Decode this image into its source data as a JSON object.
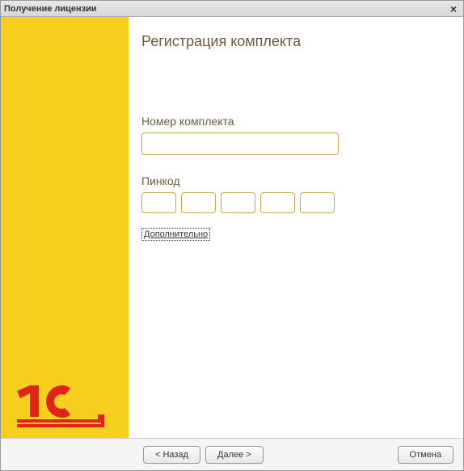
{
  "window": {
    "title": "Получение лицензии"
  },
  "main": {
    "heading": "Регистрация комплекта",
    "kit_label": "Номер комплекта",
    "kit_value": "",
    "pin_label": "Пинкод",
    "pin_values": [
      "",
      "",
      "",
      "",
      ""
    ],
    "additional_link": "Дополнительно"
  },
  "footer": {
    "back_label": "< Назад",
    "next_label": "Далее >",
    "cancel_label": "Отмена"
  },
  "colors": {
    "brand_yellow": "#f7cf1f",
    "brand_red": "#e2231a",
    "text_brown": "#6b5a3a",
    "input_border": "#c4a847"
  }
}
